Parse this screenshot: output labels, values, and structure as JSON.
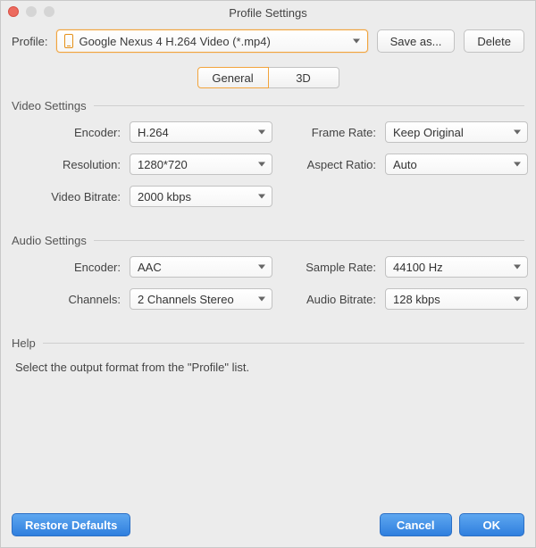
{
  "window": {
    "title": "Profile Settings"
  },
  "toolbar": {
    "profile_label": "Profile:",
    "profile_value": "Google Nexus 4 H.264 Video (*.mp4)",
    "save_as": "Save as...",
    "delete": "Delete"
  },
  "tabs": {
    "general": "General",
    "three_d": "3D"
  },
  "video": {
    "section": "Video Settings",
    "encoder_label": "Encoder:",
    "encoder_value": "H.264",
    "frame_rate_label": "Frame Rate:",
    "frame_rate_value": "Keep Original",
    "resolution_label": "Resolution:",
    "resolution_value": "1280*720",
    "aspect_ratio_label": "Aspect Ratio:",
    "aspect_ratio_value": "Auto",
    "video_bitrate_label": "Video Bitrate:",
    "video_bitrate_value": "2000 kbps"
  },
  "audio": {
    "section": "Audio Settings",
    "encoder_label": "Encoder:",
    "encoder_value": "AAC",
    "sample_rate_label": "Sample Rate:",
    "sample_rate_value": "44100 Hz",
    "channels_label": "Channels:",
    "channels_value": "2 Channels Stereo",
    "audio_bitrate_label": "Audio Bitrate:",
    "audio_bitrate_value": "128 kbps"
  },
  "help": {
    "section": "Help",
    "text": "Select the output format from the \"Profile\" list."
  },
  "footer": {
    "restore": "Restore Defaults",
    "cancel": "Cancel",
    "ok": "OK"
  }
}
